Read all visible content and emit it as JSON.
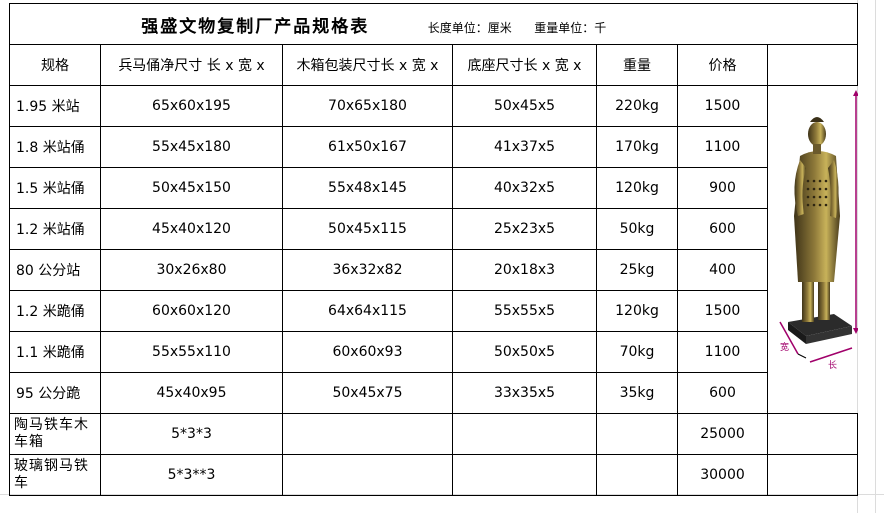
{
  "title": "强盛文物复制厂产品规格表",
  "unit_length": "长度单位：厘米",
  "unit_weight": "重量单位：千",
  "headers": {
    "spec": "规格",
    "net_size": "兵马俑净尺寸 长 x 宽 x",
    "crate_size": "木箱包装尺寸长 x 宽 x",
    "base_size": "底座尺寸长 x 宽 x",
    "weight": "重量",
    "price": "价格"
  },
  "rows": [
    {
      "name": "1.95 米站",
      "net": "65x60x195",
      "crate": "70x65x180",
      "base": "50x45x5",
      "weight": "220kg",
      "price": "1500"
    },
    {
      "name": "1.8 米站俑",
      "net": "55x45x180",
      "crate": "61x50x167",
      "base": "41x37x5",
      "weight": "170kg",
      "price": "1100"
    },
    {
      "name": "1.5 米站俑",
      "net": "50x45x150",
      "crate": "55x48x145",
      "base": "40x32x5",
      "weight": "120kg",
      "price": "900"
    },
    {
      "name": "1.2 米站俑",
      "net": "45x40x120",
      "crate": "50x45x115",
      "base": "25x23x5",
      "weight": "50kg",
      "price": "600"
    },
    {
      "name": "80 公分站",
      "net": "30x26x80",
      "crate": "36x32x82",
      "base": "20x18x3",
      "weight": "25kg",
      "price": "400"
    },
    {
      "name": "1.2 米跪俑",
      "net": "60x60x120",
      "crate": "64x64x115",
      "base": "55x55x5",
      "weight": "120kg",
      "price": "1500"
    },
    {
      "name": "1.1 米跪俑",
      "net": "55x55x110",
      "crate": "60x60x93",
      "base": "50x50x5",
      "weight": "70kg",
      "price": "1100"
    },
    {
      "name": "95 公分跪",
      "net": "45x40x95",
      "crate": "50x45x75",
      "base": "33x35x5",
      "weight": "35kg",
      "price": "600"
    }
  ],
  "extra_rows": [
    {
      "name": "陶马铁车木车箱",
      "net": "5*3*3",
      "price": "25000"
    },
    {
      "name": "玻璃钢马铁车",
      "net": "5*3**3",
      "price": "30000"
    }
  ],
  "statue_labels": {
    "width_mark": "宽",
    "length_mark": "长"
  },
  "colors": {
    "statue_bronze": "#6b5a2c",
    "statue_highlight": "#c8b25a",
    "dimension_line": "#a0006a"
  }
}
